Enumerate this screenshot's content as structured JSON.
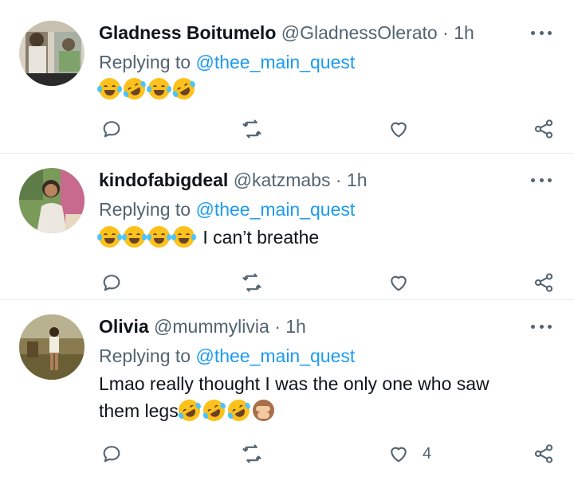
{
  "tweets": [
    {
      "name": "Gladness Boitumelo",
      "handle": "@GladnessOlerato",
      "time": "1h",
      "reply_prefix": "Replying to",
      "reply_mention": "@thee_main_quest",
      "text": "",
      "emojis": [
        "face-with-tears-of-joy",
        "rolling-on-the-floor-laughing",
        "face-with-tears-of-joy",
        "rolling-on-the-floor-laughing"
      ],
      "like_count": ""
    },
    {
      "name": "kindofabigdeal",
      "handle": "@katzmabs",
      "time": "1h",
      "reply_prefix": "Replying to",
      "reply_mention": "@thee_main_quest",
      "text": "I can’t breathe",
      "emojis": [
        "face-with-tears-of-joy",
        "face-with-tears-of-joy",
        "face-with-tears-of-joy",
        "face-with-tears-of-joy"
      ],
      "like_count": ""
    },
    {
      "name": "Olivia",
      "handle": "@mummylivia",
      "time": "1h",
      "reply_prefix": "Replying to",
      "reply_mention": "@thee_main_quest",
      "text_line1": "Lmao really thought I was the only one who saw",
      "text_line2": "them legs",
      "emojis": [
        "rolling-on-the-floor-laughing",
        "rolling-on-the-floor-laughing",
        "rolling-on-the-floor-laughing",
        "see-no-evil-monkey"
      ],
      "like_count": "4"
    }
  ],
  "separator": "·",
  "colors": {
    "text": "#0f1419",
    "secondary": "#536471",
    "link": "#1d9bf0",
    "divider": "#e6ecf0"
  },
  "icons": {
    "reply": "reply-icon",
    "retweet": "retweet-icon",
    "like": "heart-icon",
    "share": "share-icon",
    "more": "more-icon"
  }
}
